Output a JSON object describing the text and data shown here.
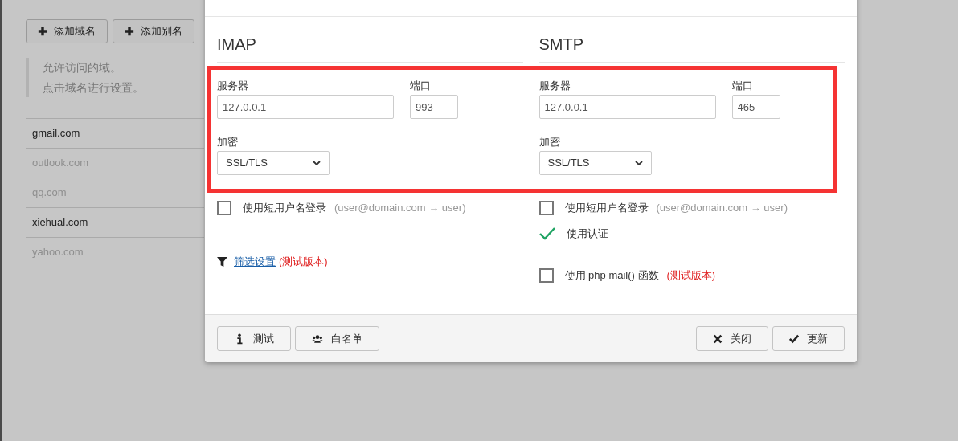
{
  "page": {
    "buttons": [
      {
        "label": "添加域名"
      },
      {
        "label": "添加别名"
      }
    ],
    "hint": [
      "允许访问的域。",
      "点击域名进行设置。"
    ],
    "domains": [
      {
        "name": "gmail.com",
        "enabled": true
      },
      {
        "name": "outlook.com",
        "enabled": false
      },
      {
        "name": "qq.com",
        "enabled": false
      },
      {
        "name": "xiehual.com",
        "enabled": true
      },
      {
        "name": "yahoo.com",
        "enabled": false
      }
    ]
  },
  "dialog": {
    "sections": [
      {
        "heading": "IMAP",
        "server_label": "服务器",
        "server": "127.0.0.1",
        "port_label": "端口",
        "port": "993",
        "encryption_label": "加密",
        "encryption": "SSL/TLS",
        "options": [
          {
            "kind": "checkbox",
            "label": "使用短用户名登录",
            "note": "(user@domain.com → user)",
            "checked": false
          },
          {
            "kind": "link",
            "label": "筛选设置",
            "note": "(测试版本)"
          }
        ]
      },
      {
        "heading": "SMTP",
        "server_label": "服务器",
        "server": "127.0.0.1",
        "port_label": "端口",
        "port": "465",
        "encryption_label": "加密",
        "encryption": "SSL/TLS",
        "options": [
          {
            "kind": "checkbox",
            "label": "使用短用户名登录",
            "note": "(user@domain.com → user)",
            "checked": false
          },
          {
            "kind": "checkbox",
            "label": "使用认证",
            "checked": true
          },
          {
            "kind": "checkbox",
            "label": "使用 php mail() 函数",
            "note": "(测试版本)",
            "checked": false
          }
        ]
      }
    ],
    "footer_left": [
      {
        "label": "测试"
      },
      {
        "label": "白名单"
      }
    ],
    "footer_right": [
      {
        "label": "关闭"
      },
      {
        "label": "更新"
      }
    ]
  }
}
